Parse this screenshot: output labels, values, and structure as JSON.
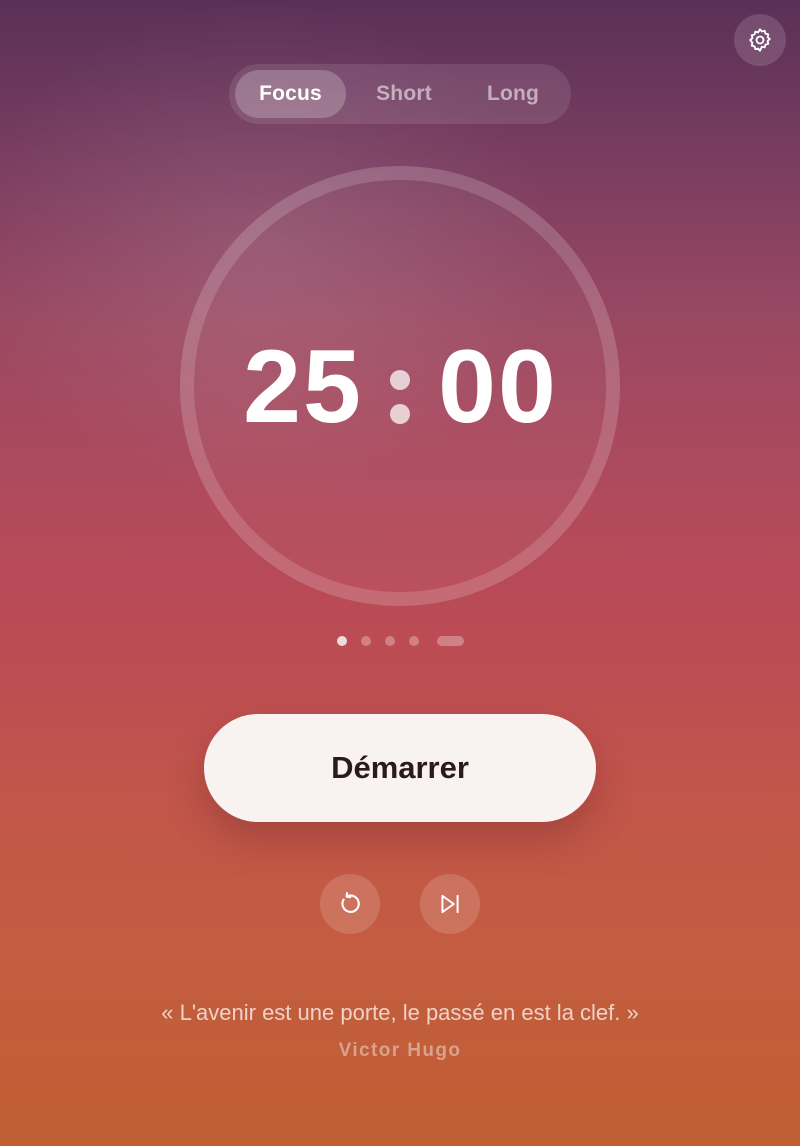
{
  "header": {
    "settings_icon": "gear-icon"
  },
  "mode_tabs": [
    {
      "label": "Focus",
      "active": true
    },
    {
      "label": "Short",
      "active": false
    },
    {
      "label": "Long",
      "active": false
    }
  ],
  "timer": {
    "minutes": "25",
    "seconds": "00",
    "progress": 0
  },
  "session_indicator": {
    "total_sessions": 5,
    "current_session": 1
  },
  "controls": {
    "start_label": "Démarrer",
    "reset_icon": "reset-icon",
    "skip_icon": "skip-forward-icon"
  },
  "quote": {
    "text": "« L'avenir est une porte, le passé en est la clef. »",
    "author": "Victor Hugo"
  },
  "colors": {
    "start_button_bg": "#f8f2f1",
    "start_button_text": "#2a1a1e",
    "gradient_top": "#5a3058",
    "gradient_bottom": "#c05e33"
  }
}
